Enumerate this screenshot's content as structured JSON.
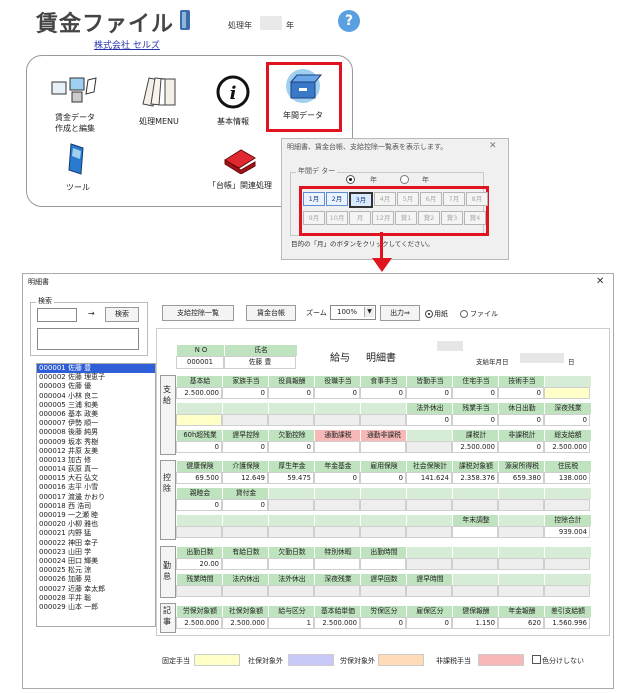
{
  "launcher": {
    "app_title": "賃金ファイル",
    "year_label": "処理年",
    "year_suffix": "年",
    "help_label": "?",
    "company": "株式会社 セルズ",
    "items": [
      {
        "label_1": "賃金データ",
        "label_2": "作成と編集",
        "icon": "data-entry-icon"
      },
      {
        "label_1": "処理MENU",
        "label_2": "",
        "icon": "documents-icon"
      },
      {
        "label_1": "基本情報",
        "label_2": "",
        "icon": "info-icon"
      },
      {
        "label_1": "年間データ",
        "label_2": "",
        "icon": "file-box-icon"
      },
      {
        "label_1": "ツール",
        "label_2": "",
        "icon": "tools-icon"
      },
      {
        "label_1": "「台帳」関連処理",
        "label_2": "",
        "icon": "ledger-book-icon"
      }
    ]
  },
  "popup": {
    "title": "明細書、賃金台帳、支給控除一覧表を表示します。",
    "close_label": "✕",
    "group_label": "年間デ ター",
    "radio_1": "年",
    "radio_2": "年",
    "months_row1": [
      "1月",
      "2月",
      "3月",
      "4月",
      "5月",
      "6月",
      "7月",
      "8月"
    ],
    "months_row2": [
      "9月",
      "10月",
      "月",
      "12月",
      "賞1",
      "賞2",
      "賞3",
      "賞4"
    ],
    "hint": "目的の「月」のボタンをクリックしてください。"
  },
  "window": {
    "title": "明細書",
    "close_label": "✕",
    "search_group": "検索",
    "search_arrow": "→",
    "search_button": "検索",
    "toolbar": {
      "btn_list": "支給控除一覧",
      "btn_ledger": "賃金台帳",
      "zoom_label": "ズーム",
      "zoom_value": "100%",
      "print_btn": "出力⇒",
      "opt_paper": "用紙",
      "opt_file": "ファイル"
    },
    "employees": [
      "000001 佐藤 豊",
      "000002 佐藤 理恵子",
      "000003 佐藤 優",
      "000004 小林 良二",
      "000005 三浦 和美",
      "000006 基本 政美",
      "000007 伊勢 順一",
      "000008 後藤 純男",
      "000009 坂本 秀樹",
      "000012 井原 友美",
      "000013 加古 修",
      "000014 荻原 真一",
      "000015 大石 弘文",
      "000016 志平 小雪",
      "000017 渡邊 かおり",
      "000018 西 浩司",
      "000019 一之瀬 睦",
      "000020 小柳 雅也",
      "000021 内野 猛",
      "000022 神田 幸子",
      "000023 山田 学",
      "000024 田口 輝美",
      "000025 松元 涼",
      "000026 加藤 晃",
      "000027 近藤 幸太郎",
      "000028 平井 聡",
      "000029 山本 一郎"
    ],
    "slip": {
      "no_label": "N O",
      "name_label": "氏名",
      "no_value": "000001",
      "name_value": "佐藤 豊",
      "title_1": "給与",
      "title_2": "明細書",
      "pay_date_label": "支給年月日",
      "pay_date_suffix": "日",
      "sections": {
        "pay": "支給",
        "deduct": "控除",
        "attend": "勤怠",
        "note": "記事"
      },
      "pay_headers_1": [
        "基本給",
        "家族手当",
        "役員報酬",
        "役職手当",
        "食事手当",
        "皆勤手当",
        "住宅手当",
        "技術手当",
        ""
      ],
      "pay_values_1": [
        "2.500.000",
        "0",
        "0",
        "0",
        "0",
        "0",
        "0",
        "0",
        ""
      ],
      "pay_headers_2": [
        "",
        "",
        "",
        "",
        "",
        "法外休出",
        "残業手当",
        "休日出勤",
        "深夜残業"
      ],
      "pay_values_2": [
        "",
        "",
        "",
        "",
        "",
        "0",
        "0",
        "0",
        "0"
      ],
      "pay_headers_3": [
        "60h超残業",
        "遅早控除",
        "欠勤控除",
        "通勤課税",
        "通勤非課税",
        "",
        "課税計",
        "非課税計",
        "総支給額"
      ],
      "pay_values_3": [
        "0",
        "0",
        "0",
        "",
        "",
        "",
        "2.500.000",
        "0",
        "2.500.000"
      ],
      "ded_headers_1": [
        "健康保険",
        "介護保険",
        "厚生年金",
        "年金基金",
        "雇用保険",
        "社会保険計",
        "課税対象額",
        "源泉所得税",
        "住民税"
      ],
      "ded_values_1": [
        "69.500",
        "12.649",
        "59.475",
        "0",
        "0",
        "141.624",
        "2.358.376",
        "659.380",
        "138.000"
      ],
      "ded_headers_2": [
        "親睦会",
        "貸付金",
        "",
        "",
        "",
        "",
        "",
        "",
        ""
      ],
      "ded_values_2": [
        "0",
        "0",
        "",
        "",
        "",
        "",
        "",
        "",
        ""
      ],
      "ded_headers_3": [
        "",
        "",
        "",
        "",
        "",
        "",
        "年末調整",
        "",
        "控除合計"
      ],
      "ded_values_3": [
        "",
        "",
        "",
        "",
        "",
        "",
        "",
        "",
        "939.004"
      ],
      "att_headers_1": [
        "出勤日数",
        "有給日数",
        "欠勤日数",
        "特別休暇",
        "出勤時間",
        "",
        "",
        "",
        ""
      ],
      "att_values_1": [
        "20.00",
        "",
        "",
        "",
        "",
        "",
        "",
        "",
        ""
      ],
      "att_headers_2": [
        "残業時間",
        "法内休出",
        "法外休出",
        "深夜残業",
        "遅早回数",
        "遅早時間",
        "",
        "",
        ""
      ],
      "note_headers": [
        "労保対象額",
        "社保対象額",
        "給与区分",
        "基本給単価",
        "労保区分",
        "雇保区分",
        "健保報酬",
        "年金報酬",
        "差引支給額"
      ],
      "note_values": [
        "2.500.000",
        "2.500.000",
        "1",
        "2.500.000",
        "0",
        "0",
        "1.150",
        "620",
        "1.560.996"
      ]
    },
    "legend": {
      "fixed": "固定手当",
      "social_ex": "社保対象外",
      "labor_ex": "労保対象外",
      "nontax": "非課税手当",
      "no_color": "色分けしない"
    },
    "colors": {
      "fixed": "#ffffc8",
      "social_ex": "#c8c8f8",
      "labor_ex": "#ffdcb8",
      "nontax": "#f7b8b8",
      "highlight_red": "#e0141e",
      "header_green": "#bfe3bf"
    }
  }
}
